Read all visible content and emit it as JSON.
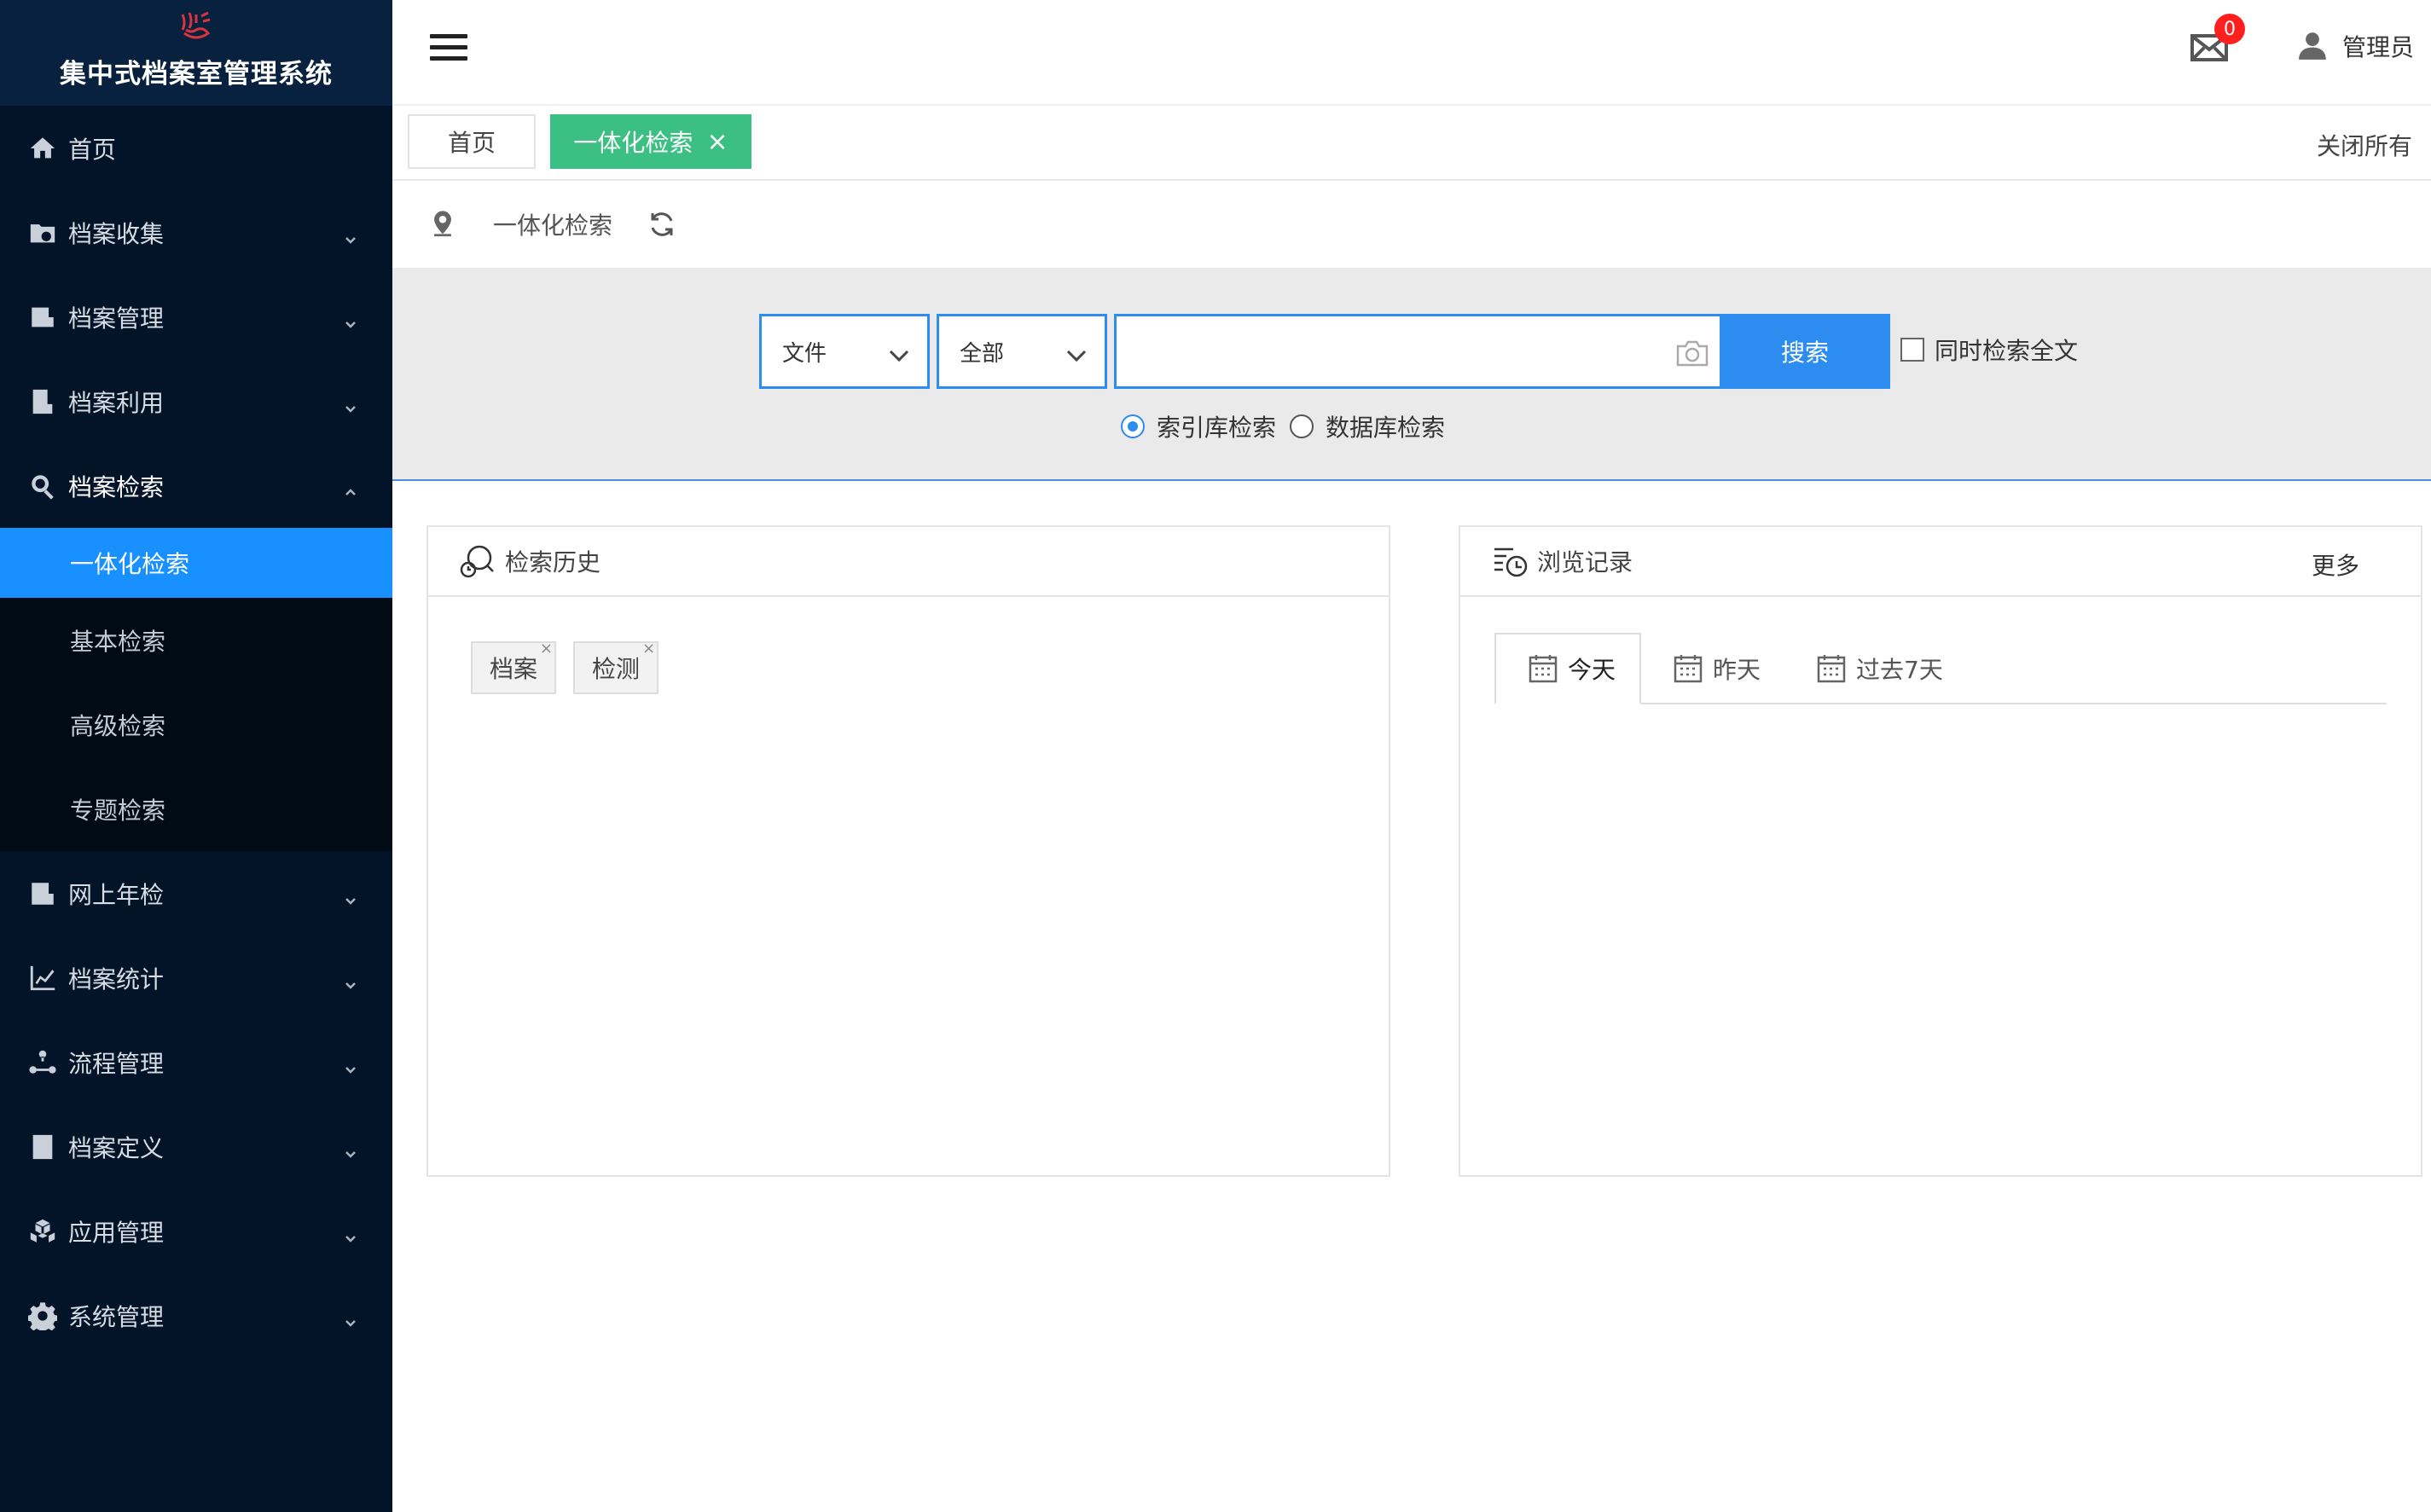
{
  "app": {
    "title": "集中式档案室管理系统"
  },
  "sidebar": {
    "items": [
      {
        "label": "首页",
        "icon": "home-icon"
      },
      {
        "label": "档案收集",
        "icon": "folder-add-icon"
      },
      {
        "label": "档案管理",
        "icon": "archive-manage-icon"
      },
      {
        "label": "档案利用",
        "icon": "document-use-icon"
      },
      {
        "label": "档案检索",
        "icon": "search-icon"
      },
      {
        "label": "网上年检",
        "icon": "annual-check-icon"
      },
      {
        "label": "档案统计",
        "icon": "line-chart-icon"
      },
      {
        "label": "流程管理",
        "icon": "workflow-icon"
      },
      {
        "label": "档案定义",
        "icon": "definition-icon"
      },
      {
        "label": "应用管理",
        "icon": "cubes-icon"
      },
      {
        "label": "系统管理",
        "icon": "gear-icon"
      }
    ],
    "search_sub": [
      "一体化检索",
      "基本检索",
      "高级检索",
      "专题检索"
    ]
  },
  "header": {
    "mail_count": "0",
    "user_name": "管理员"
  },
  "tabs": {
    "home": "首页",
    "active": "一体化检索",
    "close_icon": "×",
    "close_all": "关闭所有"
  },
  "breadcrumb": {
    "current": "一体化检索"
  },
  "search": {
    "type_selected": "文件",
    "scope_selected": "全部",
    "query_value": "",
    "query_placeholder": "",
    "button": "搜索",
    "fulltext_label": "同时检索全文",
    "radio_index": "索引库检索",
    "radio_db": "数据库检索"
  },
  "history": {
    "title": "检索历史",
    "tags": [
      "档案",
      "检测"
    ],
    "tag_close": "×"
  },
  "browse": {
    "title": "浏览记录",
    "more": "更多",
    "tabs": [
      "今天",
      "昨天",
      "过去7天"
    ]
  },
  "colors": {
    "sidebar_bg": "#031428",
    "active_blue": "#1890ff",
    "tab_green": "#3cbf82",
    "badge_red": "#ff1f1f"
  }
}
